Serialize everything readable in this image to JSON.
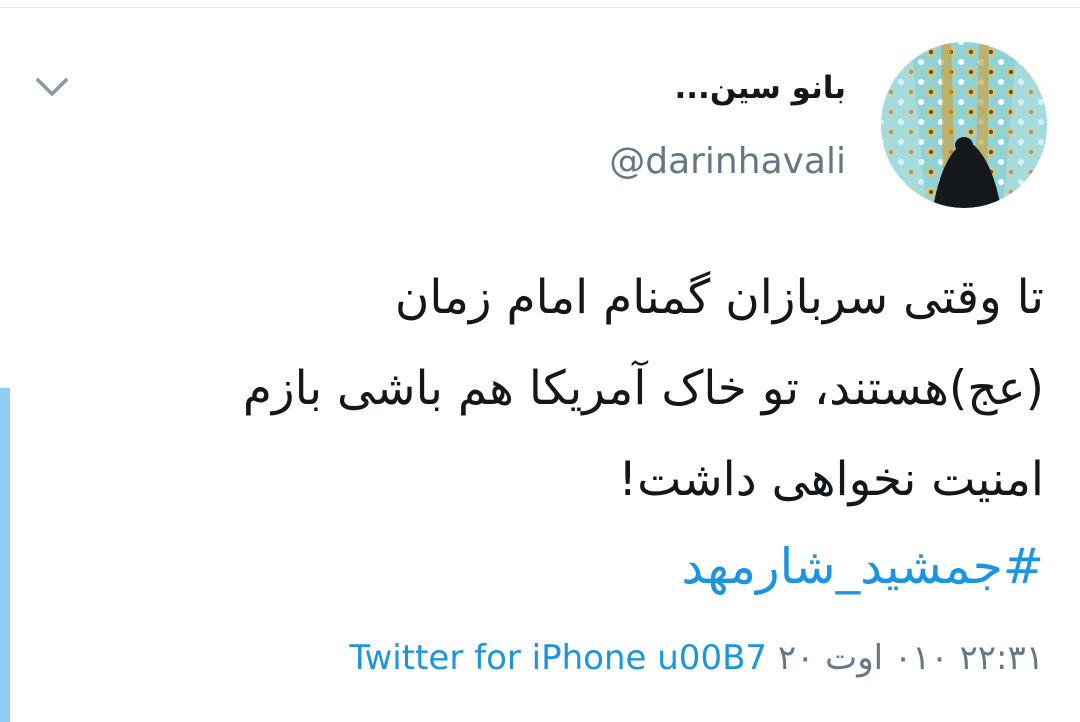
{
  "tweet": {
    "author": {
      "display_name": "بانو سین...",
      "handle": "@darinhavali",
      "avatar": "profile-photo"
    },
    "text_lines": [
      "تا وقتی سربازان گمنام امام زمان",
      "(عج)هستند، تو خاک آمریکا هم باشی بازم",
      "امنیت نخواهی داشت!"
    ],
    "hashtag": "#جمشید_شارمهد",
    "meta": {
      "source": "Twitter for iPhone",
      "separator": " u00B7 ",
      "datetime": "۲۲:۳۱ ۰۱۰ اوت ۲۰"
    },
    "menu_icon": "chevron-down-icon",
    "colors": {
      "link": "#1b95e0",
      "text": "#14171a",
      "secondary": "#657786",
      "accent_bar": "#8ecdf5",
      "divider": "#e6ecf0"
    }
  }
}
